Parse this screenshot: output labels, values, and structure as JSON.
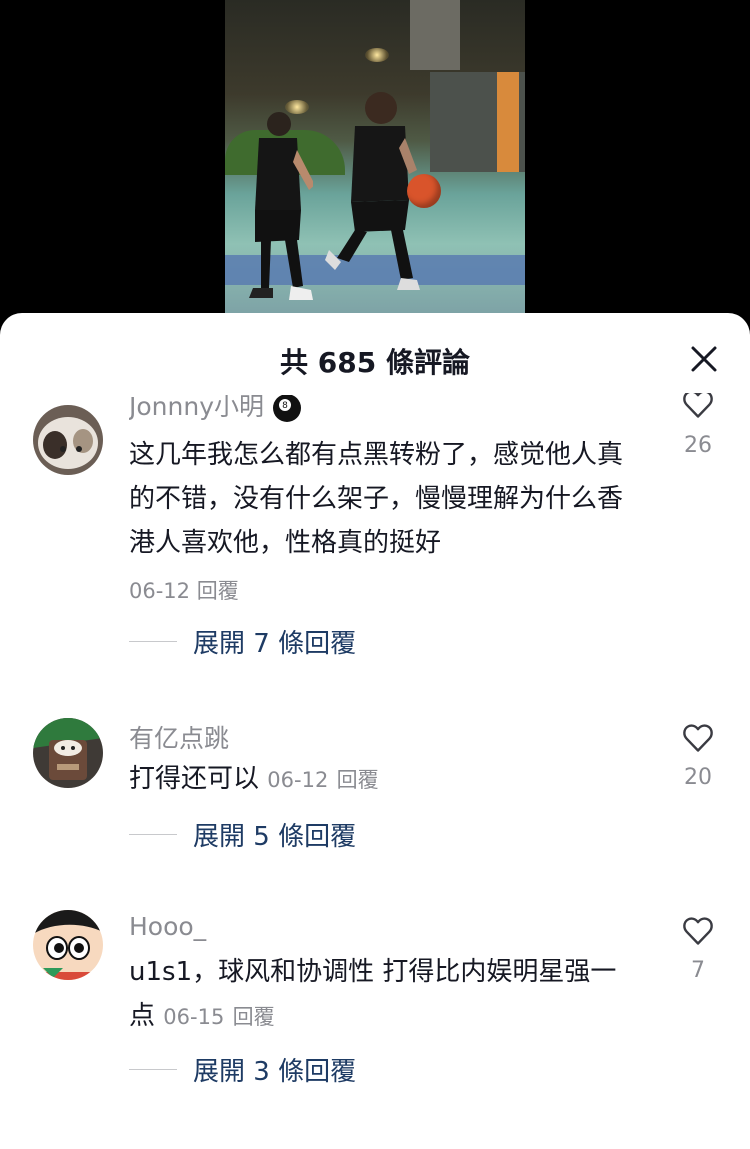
{
  "header": {
    "title": "共 685 條評論"
  },
  "comments": [
    {
      "username": "Jonnny小明",
      "text": "这几年我怎么都有点黑转粉了，感觉他人真的不错，没有什么架子，慢慢理解为什么香港人喜欢他，性格真的挺好",
      "date": "06-12",
      "reply_label": "回覆",
      "likes": "26",
      "expand_label": "展開 7 條回覆"
    },
    {
      "username": "有亿点跳",
      "text": "打得还可以",
      "date": "06-12",
      "reply_label": "回覆",
      "likes": "20",
      "expand_label": "展開 5 條回覆"
    },
    {
      "username": "Hooo_",
      "text": "u1s1，球风和协调性 打得比内娱明星强一点",
      "date": "06-15",
      "reply_label": "回覆",
      "likes": "7",
      "expand_label": "展開 3 條回覆"
    }
  ]
}
